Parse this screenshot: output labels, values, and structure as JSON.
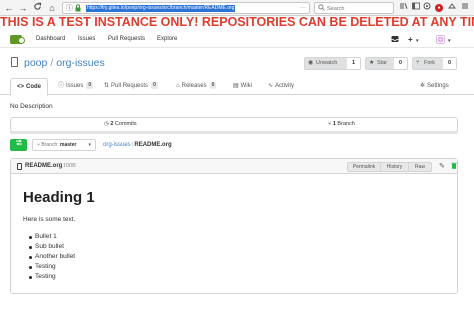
{
  "browser": {
    "back": "←",
    "forward": "→",
    "reload": "C",
    "home": "⌂",
    "url": "https://try.gitea.io/poop/org-issues/src/branch/master/README.org",
    "url_ellipsis": "···",
    "search_placeholder": "Search"
  },
  "banner": "THIS IS A TEST INSTANCE ONLY! REPOSITORIES CAN BE DELETED AT ANY TIME!",
  "header": {
    "nav": [
      "Dashboard",
      "Issues",
      "Pull Requests",
      "Explore"
    ],
    "plus": "+",
    "caret": "▾"
  },
  "repo": {
    "owner": "poop",
    "separator": "/",
    "name": "org-issues",
    "watch_label": "Unwatch",
    "watch_count": "1",
    "star_label": "Star",
    "star_count": "0",
    "fork_label": "Fork",
    "fork_count": "0"
  },
  "tabs": {
    "code": "Code",
    "issues": "Issues",
    "issues_count": "0",
    "pulls": "Pull Requests",
    "pulls_count": "0",
    "releases": "Releases",
    "releases_count": "0",
    "wiki": "Wiki",
    "activity": "Activity",
    "settings": "Settings"
  },
  "description": "No Description",
  "stats": {
    "commits_count": "2",
    "commits_label": "Commits",
    "branches_count": "1",
    "branches_label": "Branch"
  },
  "branch_bar": {
    "branch_prefix": "Branch:",
    "branch_name": "master",
    "crumb_repo": "org-issues",
    "crumb_sep": "/",
    "crumb_file": "README.org"
  },
  "file": {
    "name": "README.org",
    "size": "100B",
    "buttons": [
      "Permalink",
      "History",
      "Raw"
    ]
  },
  "content": {
    "heading": "Heading 1",
    "paragraph": "Here is some text.",
    "list": [
      "Bullet 1",
      "Sub bullet",
      "Another bullet",
      "Testing",
      "Testing"
    ]
  },
  "colors": {
    "banner": "#e03c2e",
    "link": "#4183c4",
    "gitea_green": "#609926",
    "compare_green": "#21ba45",
    "url_highlight": "#2b72d6"
  },
  "icons": {
    "lock": "lock-icon",
    "repo": "repo-icon",
    "eye": "eye-icon",
    "star": "star-icon",
    "fork": "fork-icon",
    "code": "code-icon",
    "issues": "issue-icon",
    "pulls": "pull-request-icon",
    "releases": "tag-icon",
    "wiki": "book-icon",
    "activity": "pulse-icon",
    "settings": "gear-icon",
    "commits": "history-icon",
    "branch": "branch-icon",
    "file": "file-icon",
    "edit": "pencil-icon",
    "delete": "trash-icon"
  }
}
